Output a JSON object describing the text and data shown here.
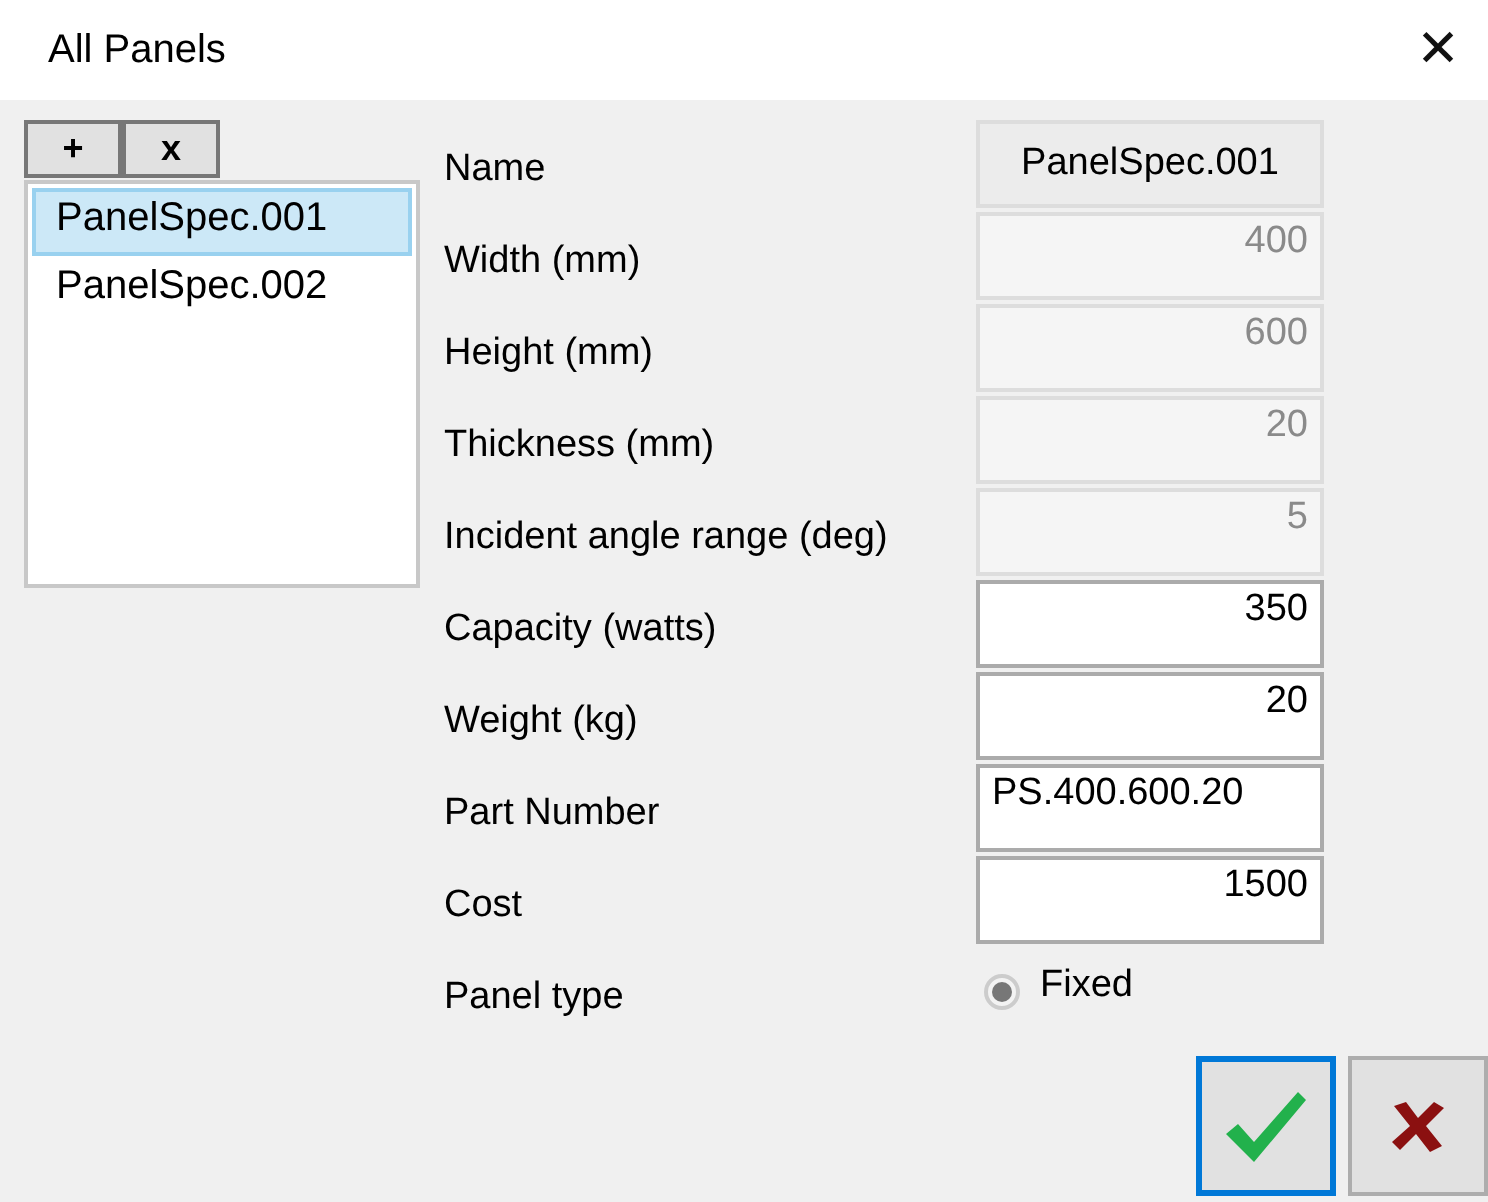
{
  "window": {
    "title": "All Panels",
    "close": "✕"
  },
  "list_buttons": [
    "+",
    "x"
  ],
  "items": [
    {
      "label": "PanelSpec.001",
      "selected": true
    },
    {
      "label": "PanelSpec.002",
      "selected": false
    }
  ],
  "fields": [
    {
      "kind": "name",
      "label": "Name",
      "value": "PanelSpec.001"
    },
    {
      "kind": "number",
      "label": "Width (mm)",
      "value": "400",
      "disabled": true
    },
    {
      "kind": "number",
      "label": "Height (mm)",
      "value": "600",
      "disabled": true
    },
    {
      "kind": "number",
      "label": "Thickness (mm)",
      "value": "20",
      "disabled": true
    },
    {
      "kind": "number",
      "label": "Incident angle range (deg)",
      "value": "5",
      "disabled": true
    },
    {
      "kind": "number",
      "label": "Capacity (watts)",
      "value": "350",
      "disabled": false
    },
    {
      "kind": "number",
      "label": "Weight (kg)",
      "value": "20",
      "disabled": false
    },
    {
      "kind": "text",
      "label": "Part Number",
      "value": "PS.400.600.20",
      "disabled": false
    },
    {
      "kind": "number",
      "label": "Cost",
      "value": "1500",
      "disabled": false
    },
    {
      "kind": "radio",
      "label": "Panel type",
      "value": "Fixed",
      "selected": true,
      "disabled": true
    }
  ],
  "actions": [
    {
      "kind": "ok",
      "focused": true
    },
    {
      "kind": "cancel",
      "focused": false
    }
  ]
}
